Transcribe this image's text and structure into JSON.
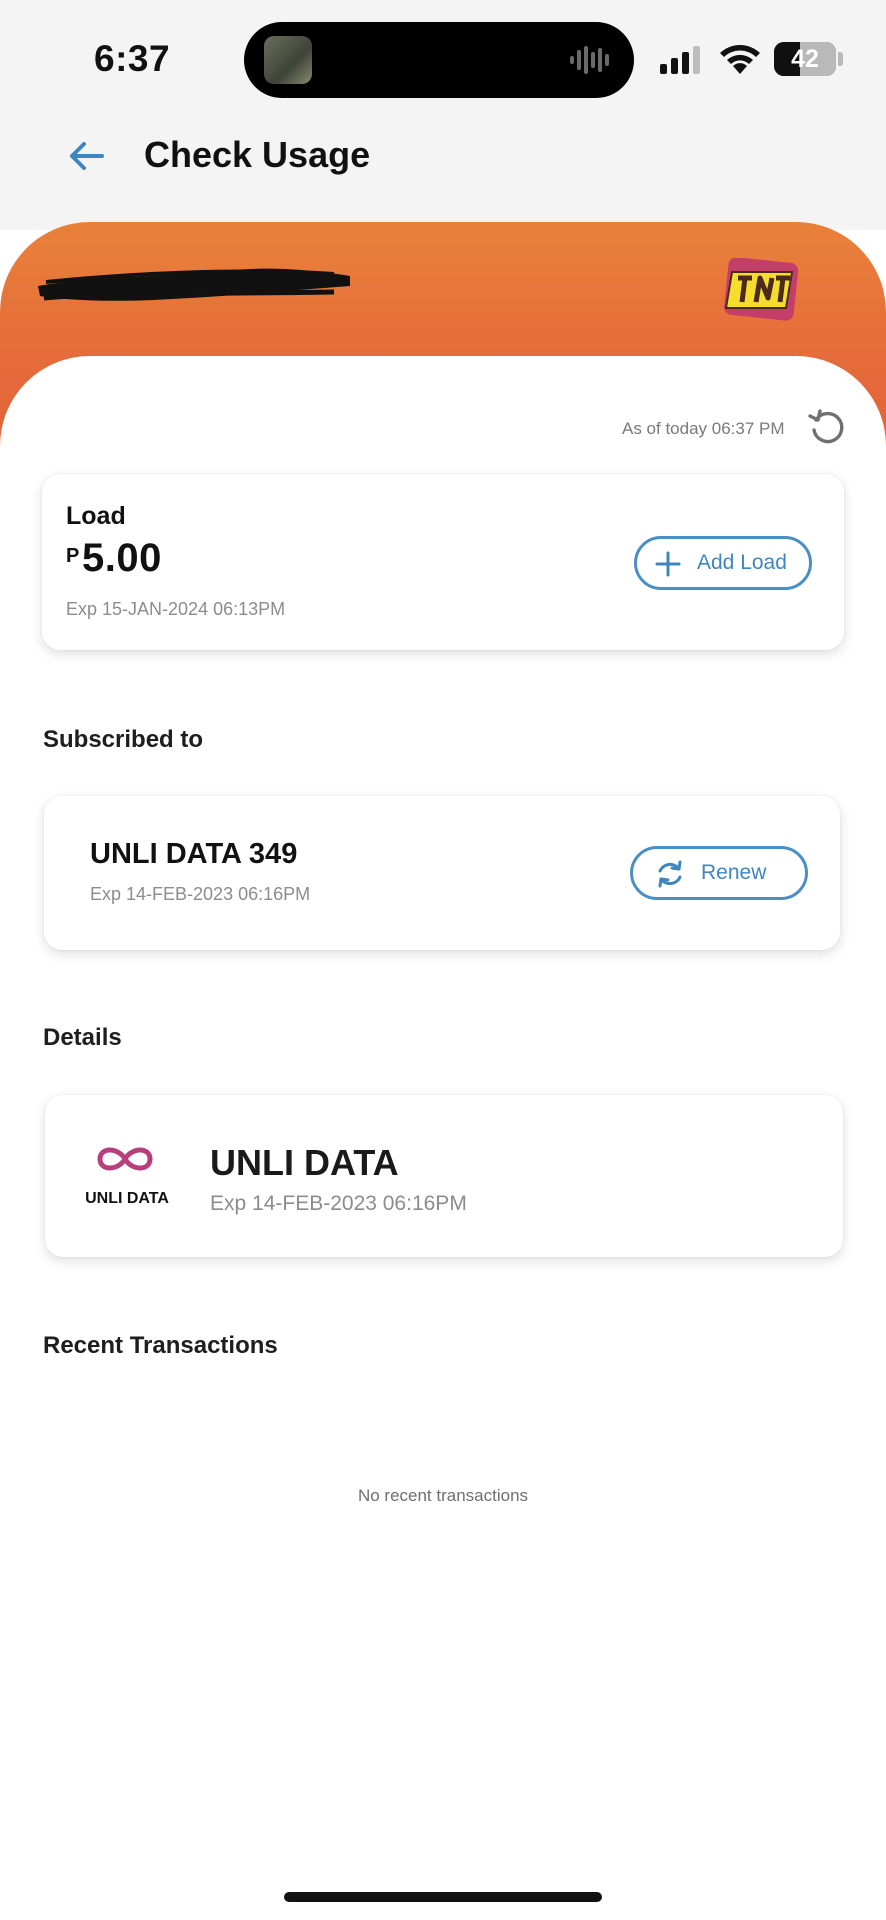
{
  "status_bar": {
    "time": "6:37",
    "battery_level": "42",
    "battery_fraction": 0.42
  },
  "header": {
    "title": "Check Usage",
    "back_icon": "arrow-left-icon"
  },
  "account": {
    "brand_logo": "TNT",
    "brand_color": "#e4693a"
  },
  "balance": {
    "as_of": "As of today 06:37 PM",
    "refresh_icon": "refresh-icon",
    "label": "Load",
    "currency": "P",
    "amount": "5.00",
    "expiry": "Exp 15-JAN-2024 06:13PM",
    "add_load_label": "Add Load"
  },
  "subscription": {
    "section_title": "Subscribed to",
    "name": "UNLI DATA 349",
    "expiry": "Exp 14-FEB-2023 06:16PM",
    "renew_label": "Renew"
  },
  "details": {
    "section_title": "Details",
    "items": [
      {
        "icon": "infinity-icon",
        "icon_label": "UNLI DATA",
        "name": "UNLI DATA",
        "expiry": "Exp 14-FEB-2023 06:16PM"
      }
    ]
  },
  "transactions": {
    "section_title": "Recent Transactions",
    "empty_text": "No recent transactions"
  },
  "colors": {
    "accent": "#3f86c0",
    "infinity": "#b8407a"
  }
}
